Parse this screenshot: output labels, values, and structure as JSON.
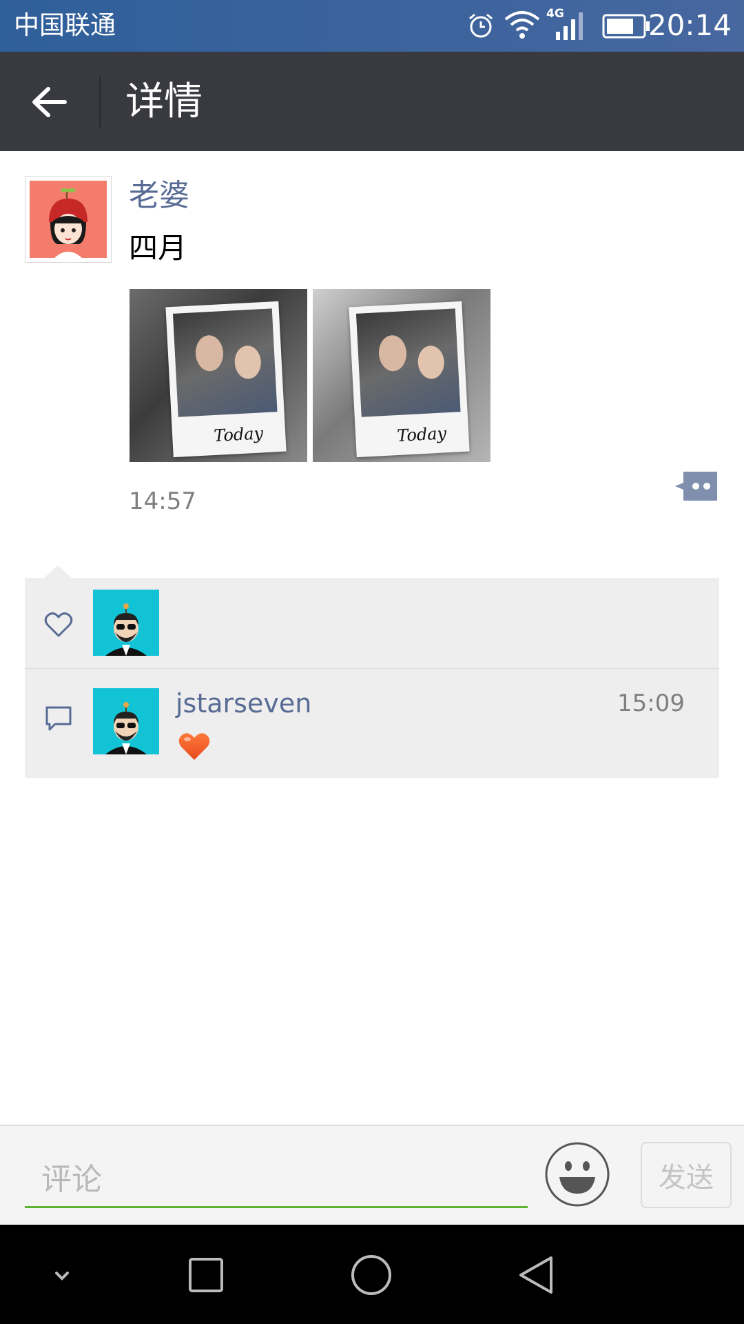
{
  "status_bar": {
    "carrier": "中国联通",
    "network": "4G",
    "time": "20:14",
    "icons": [
      "alarm-icon",
      "wifi-icon",
      "signal-icon",
      "battery-icon"
    ]
  },
  "app_bar": {
    "title": "详情",
    "back_icon": "back-arrow-icon"
  },
  "post": {
    "author": "老婆",
    "text": "四月",
    "photos": [
      {
        "caption": "Today"
      },
      {
        "caption": "Today"
      }
    ],
    "time": "14:57"
  },
  "likes": {
    "icon": "heart-icon",
    "users": [
      {
        "avatar": "bearded-man-avatar"
      }
    ]
  },
  "comments": [
    {
      "user": "jstarseven",
      "time": "15:09",
      "content_emoji": "heart-emoji"
    }
  ],
  "input_bar": {
    "placeholder": "评论",
    "value": "",
    "send_label": "发送"
  },
  "colors": {
    "status_bar": "#3a639c",
    "app_bar": "#393a3f",
    "link_name": "#576b95",
    "input_underline": "#5cb531",
    "panel_bg": "#eeeeee"
  }
}
